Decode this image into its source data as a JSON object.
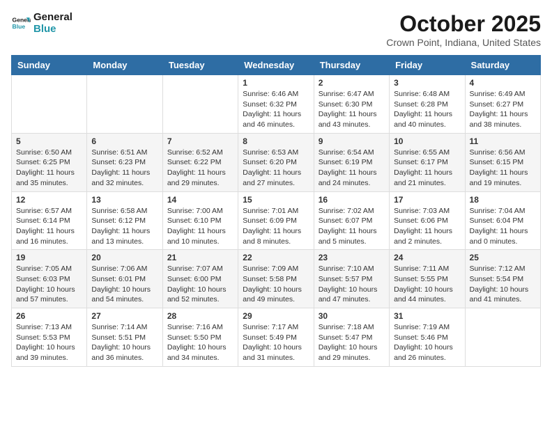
{
  "logo": {
    "line1": "General",
    "line2": "Blue"
  },
  "title": "October 2025",
  "location": "Crown Point, Indiana, United States",
  "weekdays": [
    "Sunday",
    "Monday",
    "Tuesday",
    "Wednesday",
    "Thursday",
    "Friday",
    "Saturday"
  ],
  "weeks": [
    [
      {
        "day": "",
        "info": ""
      },
      {
        "day": "",
        "info": ""
      },
      {
        "day": "",
        "info": ""
      },
      {
        "day": "1",
        "info": "Sunrise: 6:46 AM\nSunset: 6:32 PM\nDaylight: 11 hours and 46 minutes."
      },
      {
        "day": "2",
        "info": "Sunrise: 6:47 AM\nSunset: 6:30 PM\nDaylight: 11 hours and 43 minutes."
      },
      {
        "day": "3",
        "info": "Sunrise: 6:48 AM\nSunset: 6:28 PM\nDaylight: 11 hours and 40 minutes."
      },
      {
        "day": "4",
        "info": "Sunrise: 6:49 AM\nSunset: 6:27 PM\nDaylight: 11 hours and 38 minutes."
      }
    ],
    [
      {
        "day": "5",
        "info": "Sunrise: 6:50 AM\nSunset: 6:25 PM\nDaylight: 11 hours and 35 minutes."
      },
      {
        "day": "6",
        "info": "Sunrise: 6:51 AM\nSunset: 6:23 PM\nDaylight: 11 hours and 32 minutes."
      },
      {
        "day": "7",
        "info": "Sunrise: 6:52 AM\nSunset: 6:22 PM\nDaylight: 11 hours and 29 minutes."
      },
      {
        "day": "8",
        "info": "Sunrise: 6:53 AM\nSunset: 6:20 PM\nDaylight: 11 hours and 27 minutes."
      },
      {
        "day": "9",
        "info": "Sunrise: 6:54 AM\nSunset: 6:19 PM\nDaylight: 11 hours and 24 minutes."
      },
      {
        "day": "10",
        "info": "Sunrise: 6:55 AM\nSunset: 6:17 PM\nDaylight: 11 hours and 21 minutes."
      },
      {
        "day": "11",
        "info": "Sunrise: 6:56 AM\nSunset: 6:15 PM\nDaylight: 11 hours and 19 minutes."
      }
    ],
    [
      {
        "day": "12",
        "info": "Sunrise: 6:57 AM\nSunset: 6:14 PM\nDaylight: 11 hours and 16 minutes."
      },
      {
        "day": "13",
        "info": "Sunrise: 6:58 AM\nSunset: 6:12 PM\nDaylight: 11 hours and 13 minutes."
      },
      {
        "day": "14",
        "info": "Sunrise: 7:00 AM\nSunset: 6:10 PM\nDaylight: 11 hours and 10 minutes."
      },
      {
        "day": "15",
        "info": "Sunrise: 7:01 AM\nSunset: 6:09 PM\nDaylight: 11 hours and 8 minutes."
      },
      {
        "day": "16",
        "info": "Sunrise: 7:02 AM\nSunset: 6:07 PM\nDaylight: 11 hours and 5 minutes."
      },
      {
        "day": "17",
        "info": "Sunrise: 7:03 AM\nSunset: 6:06 PM\nDaylight: 11 hours and 2 minutes."
      },
      {
        "day": "18",
        "info": "Sunrise: 7:04 AM\nSunset: 6:04 PM\nDaylight: 11 hours and 0 minutes."
      }
    ],
    [
      {
        "day": "19",
        "info": "Sunrise: 7:05 AM\nSunset: 6:03 PM\nDaylight: 10 hours and 57 minutes."
      },
      {
        "day": "20",
        "info": "Sunrise: 7:06 AM\nSunset: 6:01 PM\nDaylight: 10 hours and 54 minutes."
      },
      {
        "day": "21",
        "info": "Sunrise: 7:07 AM\nSunset: 6:00 PM\nDaylight: 10 hours and 52 minutes."
      },
      {
        "day": "22",
        "info": "Sunrise: 7:09 AM\nSunset: 5:58 PM\nDaylight: 10 hours and 49 minutes."
      },
      {
        "day": "23",
        "info": "Sunrise: 7:10 AM\nSunset: 5:57 PM\nDaylight: 10 hours and 47 minutes."
      },
      {
        "day": "24",
        "info": "Sunrise: 7:11 AM\nSunset: 5:55 PM\nDaylight: 10 hours and 44 minutes."
      },
      {
        "day": "25",
        "info": "Sunrise: 7:12 AM\nSunset: 5:54 PM\nDaylight: 10 hours and 41 minutes."
      }
    ],
    [
      {
        "day": "26",
        "info": "Sunrise: 7:13 AM\nSunset: 5:53 PM\nDaylight: 10 hours and 39 minutes."
      },
      {
        "day": "27",
        "info": "Sunrise: 7:14 AM\nSunset: 5:51 PM\nDaylight: 10 hours and 36 minutes."
      },
      {
        "day": "28",
        "info": "Sunrise: 7:16 AM\nSunset: 5:50 PM\nDaylight: 10 hours and 34 minutes."
      },
      {
        "day": "29",
        "info": "Sunrise: 7:17 AM\nSunset: 5:49 PM\nDaylight: 10 hours and 31 minutes."
      },
      {
        "day": "30",
        "info": "Sunrise: 7:18 AM\nSunset: 5:47 PM\nDaylight: 10 hours and 29 minutes."
      },
      {
        "day": "31",
        "info": "Sunrise: 7:19 AM\nSunset: 5:46 PM\nDaylight: 10 hours and 26 minutes."
      },
      {
        "day": "",
        "info": ""
      }
    ]
  ]
}
